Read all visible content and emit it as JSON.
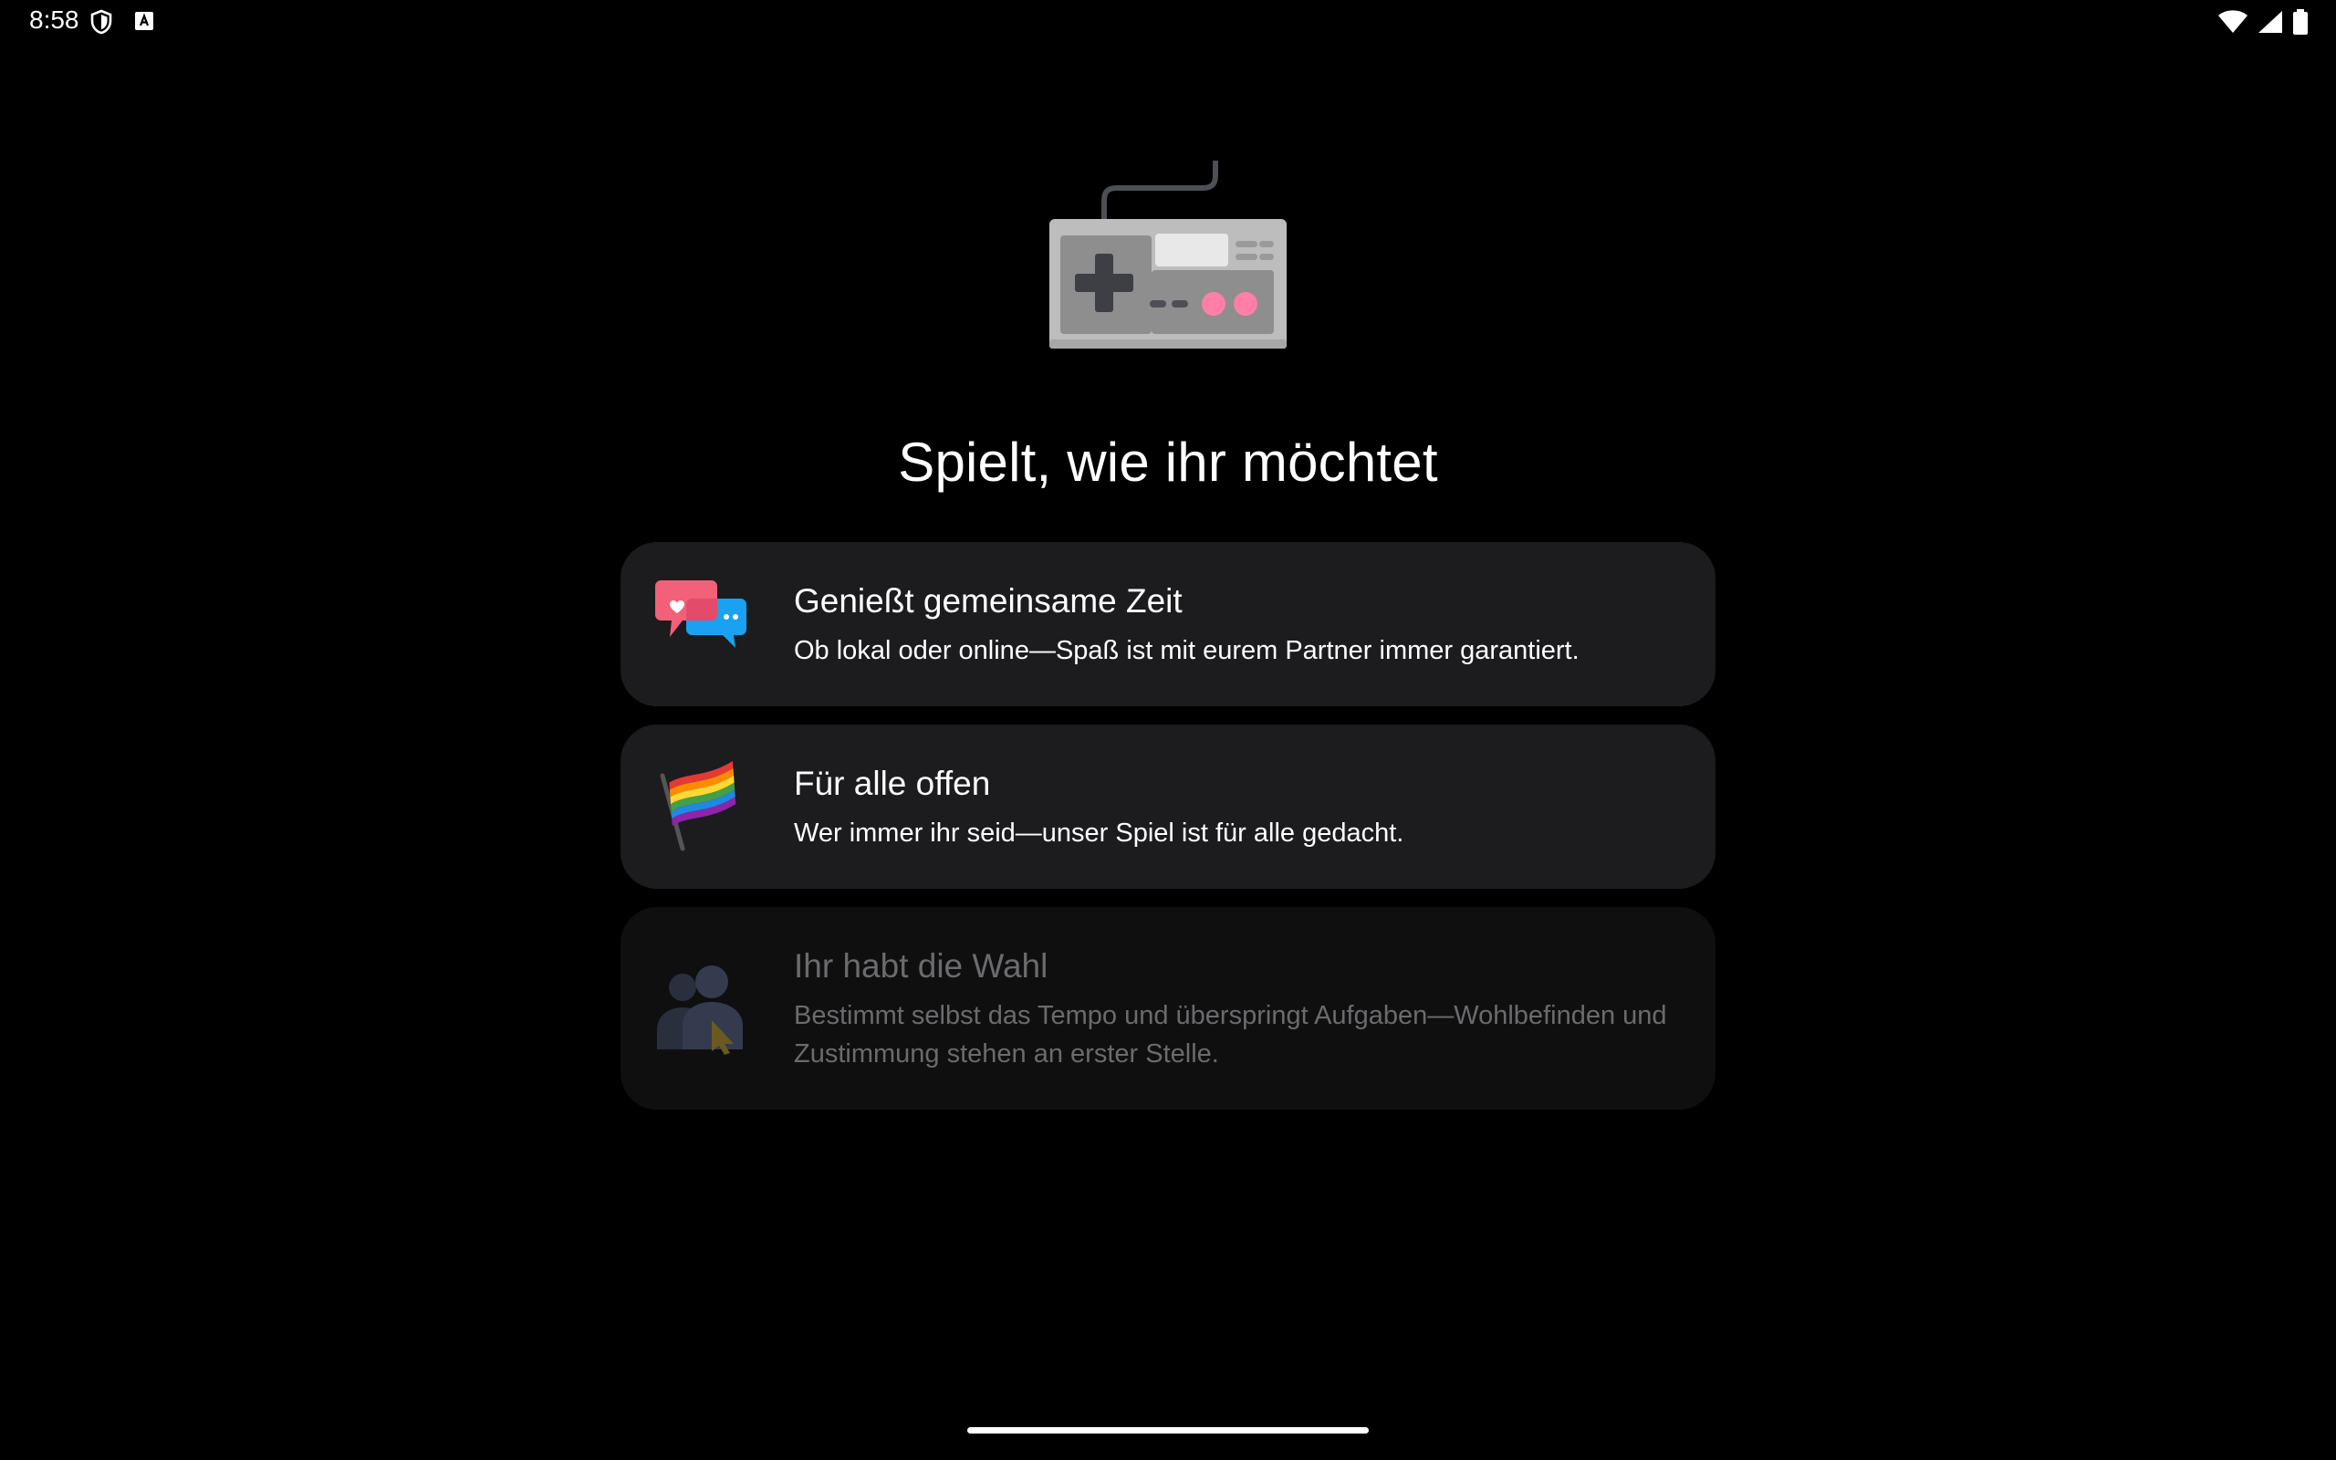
{
  "status_bar": {
    "time": "8:58",
    "left_icons": [
      "shield-icon",
      "a-notification-icon"
    ],
    "right_icons": [
      "wifi-icon",
      "signal-icon",
      "battery-icon"
    ]
  },
  "hero": {
    "icon": "gamepad-icon",
    "title": "Spielt, wie ihr möchtet"
  },
  "cards": [
    {
      "icon": "chat-bubbles-icon",
      "title": "Genießt gemeinsame Zeit",
      "description": "Ob lokal oder online—Spaß ist mit eurem Partner immer garantiert.",
      "enabled": true
    },
    {
      "icon": "rainbow-flag-icon",
      "title": "Für alle offen",
      "description": "Wer immer ihr seid—unser Spiel ist für alle gedacht.",
      "enabled": true
    },
    {
      "icon": "people-choice-icon",
      "title": "Ihr habt die Wahl",
      "description": "Bestimmt selbst das Tempo und überspringt Aufgaben—Wohlbefinden und Zustimmung stehen an erster Stelle.",
      "enabled": false
    }
  ],
  "colors": {
    "background": "#000000",
    "card_background": "#1c1c1e",
    "card_disabled_background": "#0f0f10",
    "disabled_text": "#6b6b6e",
    "accent_pink": "#ff7fa8"
  }
}
